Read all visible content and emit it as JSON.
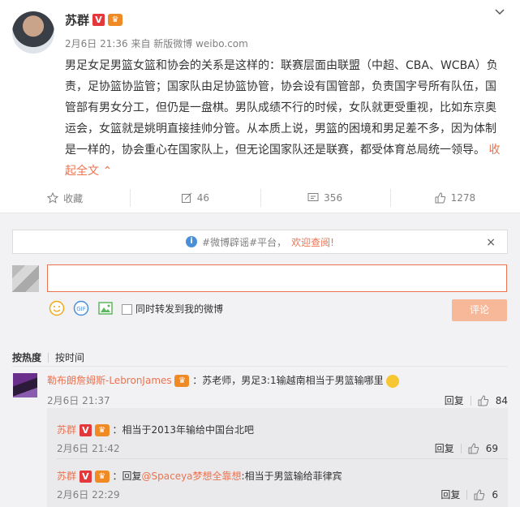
{
  "post": {
    "author": "苏群",
    "vip_badge": "V",
    "meta": "2月6日 21:36 来自 新版微博 weibo.com",
    "content": "男足女足男篮女篮和协会的关系是这样的：联赛层面由联盟（中超、CBA、WCBA）负责，足协篮协监管；国家队由足协篮协管，协会设有国管部，负责国字号所有队伍，国管部有男女分工，但仍是一盘棋。男队成绩不行的时候，女队就更受重视，比如东京奥运会，女篮就是姚明直接挂帅分管。从本质上说，男篮的困境和男足差不多，因为体制是一样的，协会重心在国家队上，但无论国家队还是联赛，都受体育总局统一领导。",
    "collapse_label": "收起全文 ⌃"
  },
  "actions": {
    "favorite": "收藏",
    "repost": "46",
    "comment": "356",
    "like": "1278"
  },
  "notice": {
    "prefix": "#微博辟谣#平台，",
    "highlight": "欢迎查阅!",
    "close": "×"
  },
  "compose": {
    "repost_option": "同时转发到我的微博",
    "submit": "评论"
  },
  "sort": {
    "by_hot": "按热度",
    "by_time": "按时间"
  },
  "comments": [
    {
      "author": "勒布朗詹姆斯-LebronJames",
      "text": "：苏老师，男足3:1输越南相当于男篮输哪里",
      "time": "2月6日 21:37",
      "reply": "回复",
      "likes": "84"
    }
  ],
  "replies": [
    {
      "author": "苏群",
      "text": "：相当于2013年输给中国台北吧",
      "time": "2月6日 21:42",
      "reply": "回复",
      "likes": "69"
    },
    {
      "author": "苏群",
      "text_prefix": "：回复",
      "mention": "@Spaceya梦想全靠想",
      "text_suffix": ":相当于男篮输给菲律宾",
      "time": "2月6日 22:29",
      "reply": "回复",
      "likes": "6"
    }
  ],
  "colors": {
    "accent": "#eb7350",
    "meta_gray": "#808080",
    "comments_bg": "#f2f2f5",
    "vip_red": "#e4393c"
  }
}
